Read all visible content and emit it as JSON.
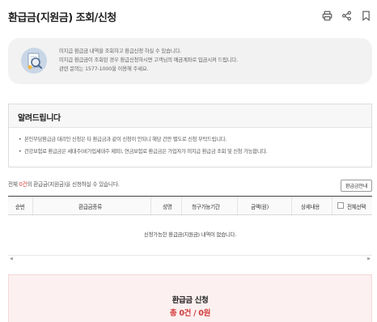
{
  "header": {
    "title": "환급금(지원금) 조회/신청",
    "icons": [
      "print-icon",
      "share-icon",
      "bookmark-icon"
    ]
  },
  "info": {
    "lines": [
      "미지급 환급금 내역을 조회하고 환급신청 하실 수 있습니다.",
      "미지급 환급금이 조회된 경우 환급신청하시면 고객님의 예금계좌로 입금시켜 드립니다.",
      "관련 문의는 1577-1000을 이용해 주세요."
    ]
  },
  "notice": {
    "title": "알려드립니다",
    "items": [
      "본인부담환급금 대리인 신청은 타 환급금과 같이 신청이 안되니 해당 건만 별도로 신청 부탁드립니다.",
      "건강보험료 환급금은 세대주(비가입세대주 제외), 연금보험료 환급금은 가입자가 미지급 환급금 조회 및 신청 가능합니다."
    ]
  },
  "summary": {
    "prefix": "전체 ",
    "count": "0건",
    "suffix": "의 환급금(지원금)을 신청하실 수 있습니다.",
    "guide_button": "환급금안내"
  },
  "table": {
    "columns": [
      "순번",
      "환급금종류",
      "성명",
      "청구가능기간",
      "금액(원)",
      "상세내용",
      "전체선택"
    ],
    "empty_message": "신청가능한 환급금(지원금) 내역이 없습니다."
  },
  "apply": {
    "title": "환급금 신청",
    "total": "총 0건 / 0원"
  },
  "colors": {
    "accent": "#d23b3b",
    "info_bg": "#f2f2f2",
    "apply_bg": "#fdf0f0"
  }
}
